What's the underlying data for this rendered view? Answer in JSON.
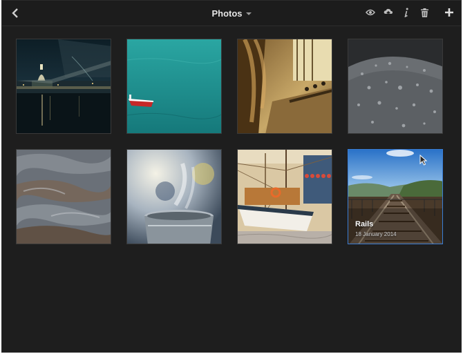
{
  "header": {
    "title": "Photos",
    "back": "chevron-left-icon",
    "actions": [
      "eye-icon",
      "upload-cloud-icon",
      "info-icon",
      "trash-icon",
      "plus-icon"
    ]
  },
  "photos": [
    {
      "subject": "london-night-skyline",
      "icon": "photo-icon"
    },
    {
      "subject": "red-boat-on-teal-water",
      "icon": "photo-icon"
    },
    {
      "subject": "sepia-cinema-seats",
      "icon": "photo-icon"
    },
    {
      "subject": "raindrops-on-surface",
      "icon": "photo-icon"
    },
    {
      "subject": "blurred-water-texture",
      "icon": "photo-icon"
    },
    {
      "subject": "steaming-cup",
      "icon": "photo-icon"
    },
    {
      "subject": "sailboat-in-harbor",
      "icon": "photo-icon"
    },
    {
      "subject": "railway-tracks",
      "icon": "photo-icon",
      "title": "Rails",
      "date": "18 January 2014",
      "selected": true
    }
  ],
  "colors": {
    "background": "#1e1e1e",
    "selection": "#3a7ed6",
    "title": "#e6e6e6"
  }
}
